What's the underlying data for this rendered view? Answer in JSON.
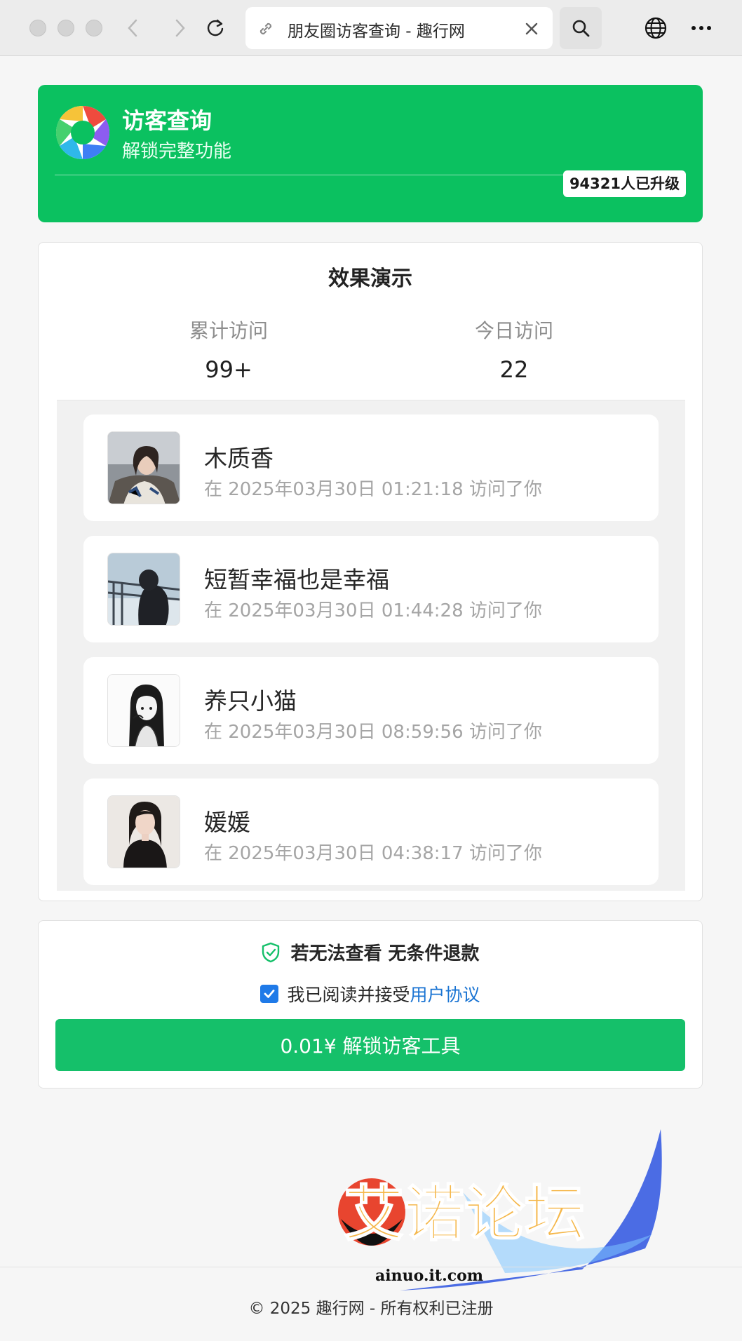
{
  "browser": {
    "tab_title": "朋友圈访客查询 - 趣行网"
  },
  "hero": {
    "title": "访客查询",
    "subtitle": "解锁完整功能",
    "badge": "94321人已升级",
    "accent_color": "#0bc160"
  },
  "demo": {
    "title": "效果演示",
    "stats": [
      {
        "label": "累计访问",
        "value": "99+"
      },
      {
        "label": "今日访问",
        "value": "22"
      }
    ],
    "visitors": [
      {
        "name": "木质香",
        "time": "在 2025年03月30日 01:21:18 访问了你"
      },
      {
        "name": "短暂幸福也是幸福",
        "time": "在 2025年03月30日 01:44:28 访问了你"
      },
      {
        "name": "养只小猫",
        "time": "在 2025年03月30日 08:59:56 访问了你"
      },
      {
        "name": "媛媛",
        "time": "在 2025年03月30日 04:38:17 访问了你"
      }
    ]
  },
  "pay": {
    "guarantee": "若无法查看 无条件退款",
    "agree_text": "我已阅读并接受",
    "agree_link": "用户协议",
    "checkbox_checked": true,
    "button": "0.01¥ 解锁访客工具",
    "button_color": "#15c06a",
    "link_color": "#1a74d3"
  },
  "watermark": {
    "logo_text": "艾诺论坛",
    "url": "ainuo.it.com"
  },
  "footer": "© 2025 趣行网 - 所有权利已注册"
}
